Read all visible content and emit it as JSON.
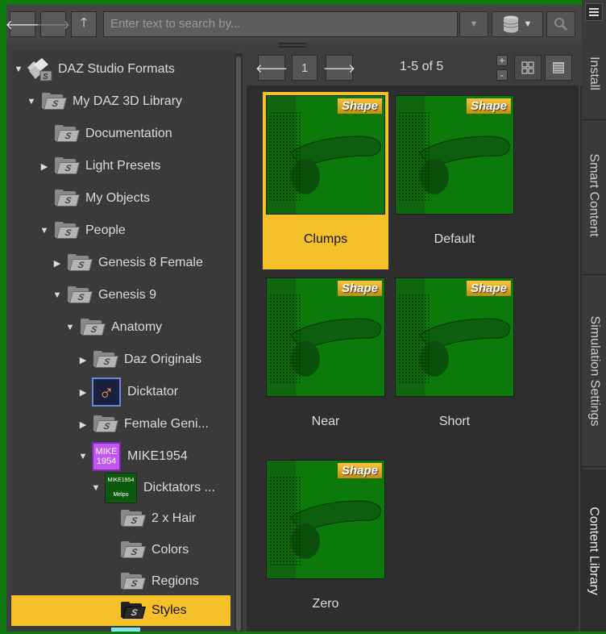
{
  "toolbar": {
    "back_icon": "back-arrow-icon",
    "forward_icon": "forward-arrow-icon",
    "up_icon": "up-arrow-icon",
    "search_placeholder": "Enter text to search by...",
    "database_icon": "database-icon",
    "search_icon": "magnifier-icon"
  },
  "tree": {
    "items": [
      {
        "label": "DAZ Studio Formats"
      },
      {
        "label": "My DAZ 3D Library"
      },
      {
        "label": "Documentation"
      },
      {
        "label": "Light Presets"
      },
      {
        "label": "My Objects"
      },
      {
        "label": "People"
      },
      {
        "label": "Genesis 8 Female"
      },
      {
        "label": "Genesis 9"
      },
      {
        "label": "Anatomy"
      },
      {
        "label": "Daz Originals"
      },
      {
        "label": "Dicktator"
      },
      {
        "label": "Female Geni..."
      },
      {
        "label": "MIKE1954",
        "badge_line1": "MIKE",
        "badge_line2": "1954"
      },
      {
        "label": "Dicktators ...",
        "badge_line1": "MIKE1954",
        "badge_line2": "Melpo"
      },
      {
        "label": "2 x Hair"
      },
      {
        "label": "Colors"
      },
      {
        "label": "Regions"
      },
      {
        "label": "Styles"
      }
    ],
    "folder_glyph": "S",
    "male_glyph": "♂"
  },
  "content": {
    "page": "1",
    "count": "1-5 of 5",
    "plus": "+",
    "minus": "-",
    "tiles": [
      {
        "label": "Clumps",
        "tag": "Shape"
      },
      {
        "label": "Default",
        "tag": "Shape"
      },
      {
        "label": "Near",
        "tag": "Shape"
      },
      {
        "label": "Short",
        "tag": "Shape"
      },
      {
        "label": "Zero",
        "tag": "Shape"
      }
    ]
  },
  "side_tabs": {
    "install": "Install",
    "smart_content": "Smart Content",
    "simulation_settings": "Simulation Settings",
    "content_library": "Content Library"
  },
  "colors": {
    "selection": "#f5c028",
    "background_frame": "#0f7a0f",
    "panel": "#3f3f3f"
  }
}
